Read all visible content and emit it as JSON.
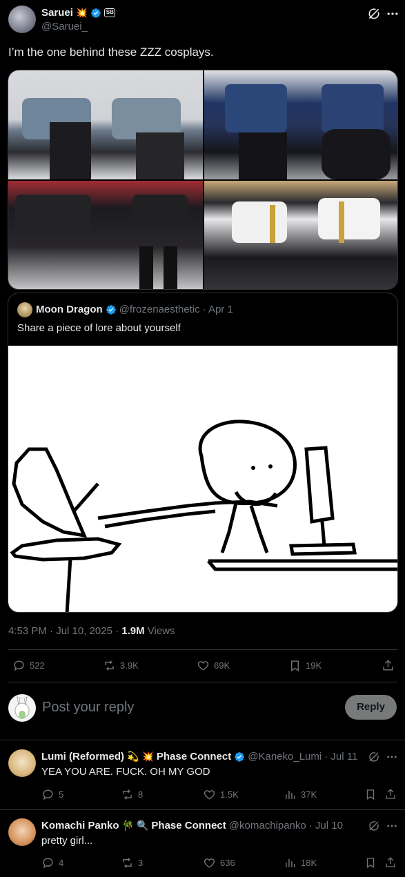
{
  "post": {
    "author_name": "Saruei",
    "author_handle": "@Saruei_",
    "text": "I’m the one behind these ZZZ cosplays.",
    "timestamp": "4:53 PM · Jul 10, 2025 · ",
    "views_count": "1.9M",
    "views_label": " Views",
    "stats": {
      "replies": "522",
      "reposts": "3.9K",
      "likes": "69K",
      "bookmarks": "19K"
    }
  },
  "quote": {
    "author_name": "Moon Dragon",
    "author_handle": "@frozenaesthetic",
    "date": "· Apr 1",
    "text": "Share a piece of lore about yourself"
  },
  "reply_box": {
    "placeholder": "Post your reply",
    "button_label": "Reply"
  },
  "replies": [
    {
      "name": "Lumi (Reformed)",
      "org": "Phase Connect",
      "handle": "@Kaneko_Lumi",
      "date": "· Jul 11",
      "text": "YEA YOU ARE. FUCK. OH MY GOD",
      "stats": {
        "replies": "5",
        "reposts": "8",
        "likes": "1.5K",
        "views": "37K"
      }
    },
    {
      "name": "Komachi Panko",
      "org": "Phase Connect",
      "handle": "@komachipanko",
      "date": "· Jul 10",
      "text": "pretty girl...",
      "stats": {
        "replies": "4",
        "reposts": "3",
        "likes": "636",
        "views": "18K"
      }
    }
  ],
  "colors": {
    "accent_blue": "#1d9bf0",
    "verified_blue": "#1d9bf0",
    "reply_button_bg": "#787a7a"
  }
}
